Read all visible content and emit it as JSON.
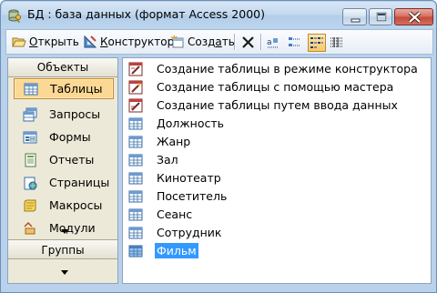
{
  "window": {
    "title": "БД : база данных (формат Access 2000)",
    "icon": "database-key-icon"
  },
  "toolbar": {
    "open_label": "Открыть",
    "open_accel": "О",
    "design_label": "Конструктор",
    "design_accel": "К",
    "create_label": "Создать",
    "create_accel": "а",
    "icons": [
      "open-icon",
      "design-icon",
      "create-icon",
      "delete-icon",
      "large-icons-view-icon",
      "small-icons-view-icon",
      "list-view-icon",
      "details-view-icon"
    ],
    "active_view": "list"
  },
  "objects": {
    "header": "Объекты",
    "items": [
      {
        "label": "Таблицы",
        "icon": "table-icon",
        "selected": true
      },
      {
        "label": "Запросы",
        "icon": "query-icon",
        "selected": false
      },
      {
        "label": "Формы",
        "icon": "form-icon",
        "selected": false
      },
      {
        "label": "Отчеты",
        "icon": "report-icon",
        "selected": false
      },
      {
        "label": "Страницы",
        "icon": "page-icon",
        "selected": false
      },
      {
        "label": "Макросы",
        "icon": "macro-icon",
        "selected": false
      },
      {
        "label": "Модули",
        "icon": "module-icon",
        "selected": false
      }
    ],
    "groups_header": "Группы"
  },
  "list": {
    "items": [
      {
        "label": "Создание таблицы в режиме конструктора",
        "icon": "wizard-design-icon",
        "selected": false
      },
      {
        "label": "Создание таблицы с помощью мастера",
        "icon": "wizard-icon",
        "selected": false
      },
      {
        "label": "Создание таблицы путем ввода данных",
        "icon": "wizard-data-icon",
        "selected": false
      },
      {
        "label": "Должность",
        "icon": "table-icon",
        "selected": false
      },
      {
        "label": "Жанр",
        "icon": "table-icon",
        "selected": false
      },
      {
        "label": "Зал",
        "icon": "table-icon",
        "selected": false
      },
      {
        "label": "Кинотеатр",
        "icon": "table-icon",
        "selected": false
      },
      {
        "label": "Посетитель",
        "icon": "table-icon",
        "selected": false
      },
      {
        "label": "Сеанс",
        "icon": "table-icon",
        "selected": false
      },
      {
        "label": "Сотрудник",
        "icon": "table-icon",
        "selected": false
      },
      {
        "label": "Фильм",
        "icon": "table-icon",
        "selected": true
      }
    ]
  },
  "colors": {
    "selection": "#3399ff",
    "object_selected": "#fbd893",
    "frame": "#b9d1ea"
  }
}
